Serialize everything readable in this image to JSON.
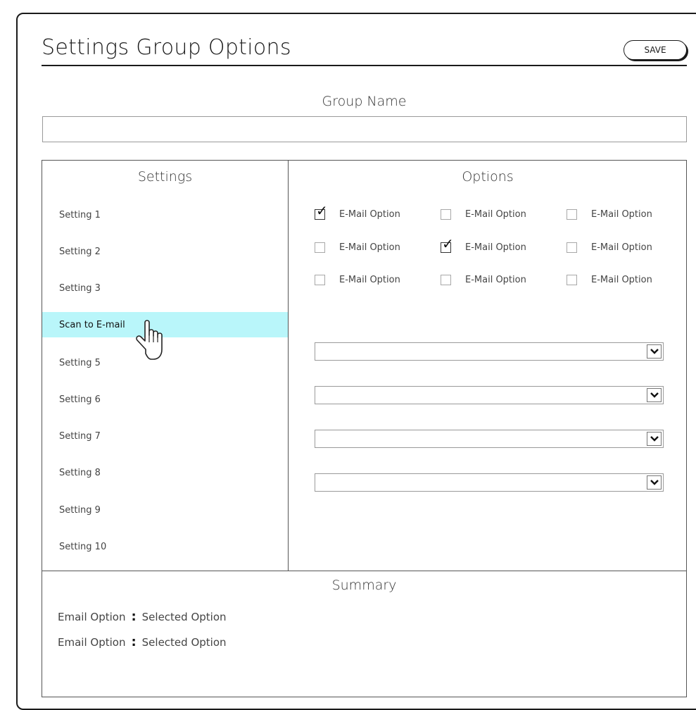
{
  "header": {
    "title": "Settings Group Options",
    "save_label": "SAVE"
  },
  "group": {
    "label": "Group Name",
    "value": ""
  },
  "settings": {
    "title": "Settings",
    "items": [
      {
        "label": "Setting 1",
        "active": false
      },
      {
        "label": "Setting 2",
        "active": false
      },
      {
        "label": "Setting 3",
        "active": false
      },
      {
        "label": "Scan to E-mail",
        "active": true
      },
      {
        "label": "Setting 5",
        "active": false
      },
      {
        "label": "Setting 6",
        "active": false
      },
      {
        "label": "Setting 7",
        "active": false
      },
      {
        "label": "Setting 8",
        "active": false
      },
      {
        "label": "Setting 9",
        "active": false
      },
      {
        "label": "Setting 10",
        "active": false
      }
    ]
  },
  "options": {
    "title": "Options",
    "checkboxes": [
      {
        "label": "E-Mail Option",
        "checked": true
      },
      {
        "label": "E-Mail Option",
        "checked": false
      },
      {
        "label": "E-Mail Option",
        "checked": false
      },
      {
        "label": "E-Mail Option",
        "checked": false
      },
      {
        "label": "E-Mail Option",
        "checked": true
      },
      {
        "label": "E-Mail Option",
        "checked": false
      },
      {
        "label": "E-Mail Option",
        "checked": false
      },
      {
        "label": "E-Mail Option",
        "checked": false
      },
      {
        "label": "E-Mail Option",
        "checked": false
      }
    ],
    "dropdowns": [
      {
        "value": "",
        "icon": "chevron-down-icon"
      },
      {
        "value": "",
        "icon": "chevron-down-icon"
      },
      {
        "value": "",
        "icon": "chevron-down-icon"
      },
      {
        "value": "",
        "icon": "chevron-down-icon"
      }
    ]
  },
  "summary": {
    "title": "Summary",
    "lines": [
      {
        "key": "Email Option",
        "sep": ":",
        "value": "Selected Option"
      },
      {
        "key": "Email Option",
        "sep": ":",
        "value": "Selected Option"
      }
    ]
  },
  "colors": {
    "active_highlight": "#b9f6fa",
    "ink": "#1a1a1a"
  },
  "cursor": {
    "icon": "hand-pointer-icon"
  }
}
